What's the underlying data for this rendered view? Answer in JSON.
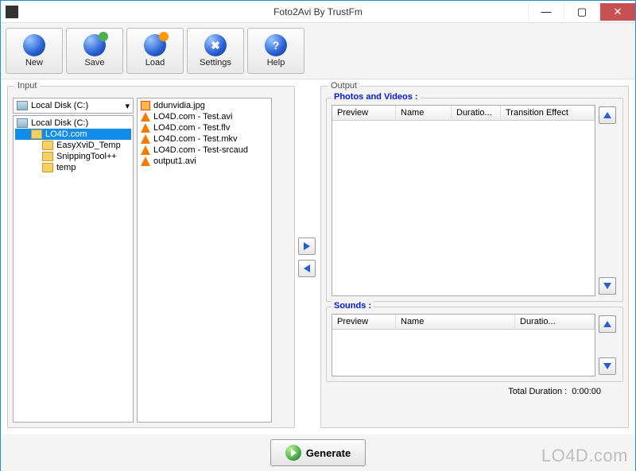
{
  "window": {
    "title": "Foto2Avi By TrustFm"
  },
  "toolbar": {
    "new_label": "New",
    "save_label": "Save",
    "load_label": "Load",
    "settings_label": "Settings",
    "help_label": "Help"
  },
  "input": {
    "group_title": "Input",
    "drive_selected": "Local Disk (C:)",
    "tree": [
      {
        "label": "Local Disk (C:)",
        "type": "drive",
        "indent": 0,
        "selected": false
      },
      {
        "label": "LO4D.com",
        "type": "folder",
        "indent": 1,
        "selected": true
      },
      {
        "label": "EasyXviD_Temp",
        "type": "folder",
        "indent": 2,
        "selected": false
      },
      {
        "label": "SnippingTool++",
        "type": "folder",
        "indent": 2,
        "selected": false
      },
      {
        "label": "temp",
        "type": "folder",
        "indent": 2,
        "selected": false
      }
    ],
    "files": [
      {
        "name": "ddunvidia.jpg",
        "type": "img"
      },
      {
        "name": "LO4D.com - Test.avi",
        "type": "video"
      },
      {
        "name": "LO4D.com - Test.flv",
        "type": "video"
      },
      {
        "name": "LO4D.com - Test.mkv",
        "type": "video"
      },
      {
        "name": "LO4D.com - Test-srcaud",
        "type": "video"
      },
      {
        "name": "output1.avi",
        "type": "video"
      }
    ]
  },
  "output": {
    "group_title": "Output",
    "photos": {
      "title": "Photos and Videos :",
      "columns": [
        "Preview",
        "Name",
        "Duratio...",
        "Transition Effect"
      ]
    },
    "sounds": {
      "title": "Sounds :",
      "columns": [
        "Preview",
        "Name",
        "Duratio..."
      ]
    },
    "total_label": "Total Duration :",
    "total_value": "0:00:00"
  },
  "generate": {
    "label": "Generate"
  },
  "watermark": "LO4D.com"
}
